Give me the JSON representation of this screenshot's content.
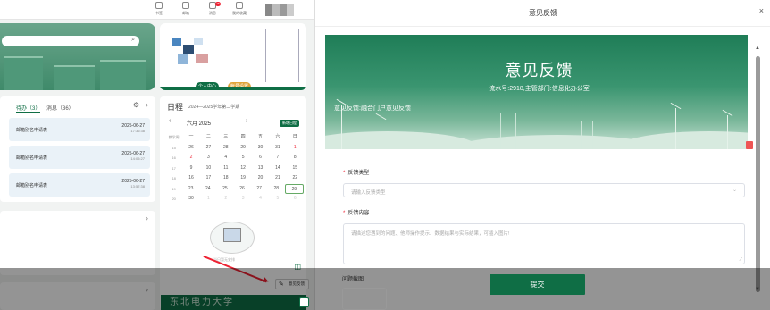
{
  "portal": {
    "nav": [
      {
        "label": "书签"
      },
      {
        "label": "邮箱"
      },
      {
        "label": "消息",
        "badge": "15"
      },
      {
        "label": "我的收藏"
      }
    ],
    "profile": {
      "btn_personal": "个人中心",
      "btn_account": "帐号设置"
    },
    "todo": {
      "tab_todo": "待办（3）",
      "tab_msg": "消息（36）",
      "items": [
        {
          "title": "邮箱别名申请表",
          "date": "2025-06-27",
          "time": "17:36:38"
        },
        {
          "title": "邮箱别名申请表",
          "date": "2025-06-27",
          "time": "14:05:27"
        },
        {
          "title": "邮箱别名申请表",
          "date": "2025-06-27",
          "time": "13:57:38"
        }
      ]
    },
    "calendar": {
      "title": "日程",
      "term": "2024—2025学年第二学期",
      "month": "六月 2025",
      "new_btn": "新增日程",
      "weekday_headers": [
        "教学周",
        "一",
        "二",
        "三",
        "四",
        "五",
        "六",
        "日"
      ],
      "rows": [
        [
          "15",
          "26",
          "27",
          "28",
          "29",
          "30",
          "31",
          "1"
        ],
        [
          "16",
          "2",
          "3",
          "4",
          "5",
          "6",
          "7",
          "8"
        ],
        [
          "17",
          "9",
          "10",
          "11",
          "12",
          "13",
          "14",
          "15"
        ],
        [
          "18",
          "16",
          "17",
          "18",
          "19",
          "20",
          "21",
          "22"
        ],
        [
          "19",
          "23",
          "24",
          "25",
          "26",
          "27",
          "28",
          "29"
        ],
        [
          "20",
          "30",
          "1",
          "2",
          "3",
          "4",
          "5",
          "6"
        ]
      ],
      "empty_text": "当日暂无安排"
    },
    "feedback_tab": "意见反馈",
    "school_name": "东北电力大学"
  },
  "dialog": {
    "title": "意见反馈",
    "close": "×",
    "banner": {
      "title": "意见反馈",
      "sub": "流水号:2918,主管部门:信息化办公室",
      "desc": "意见反馈:融合门户意见反馈"
    },
    "form": {
      "type_label": "反馈类型",
      "type_placeholder": "请输入反馈类型",
      "content_label": "反馈内容",
      "content_placeholder": "请描述您遇到的问题、他师操作提示、数据结果与实际结果，可插入图片!",
      "upload_label": "问题截图",
      "submit": "提交"
    }
  },
  "colors": {
    "primary": "#0f6e45",
    "danger": "#e23a3a"
  }
}
